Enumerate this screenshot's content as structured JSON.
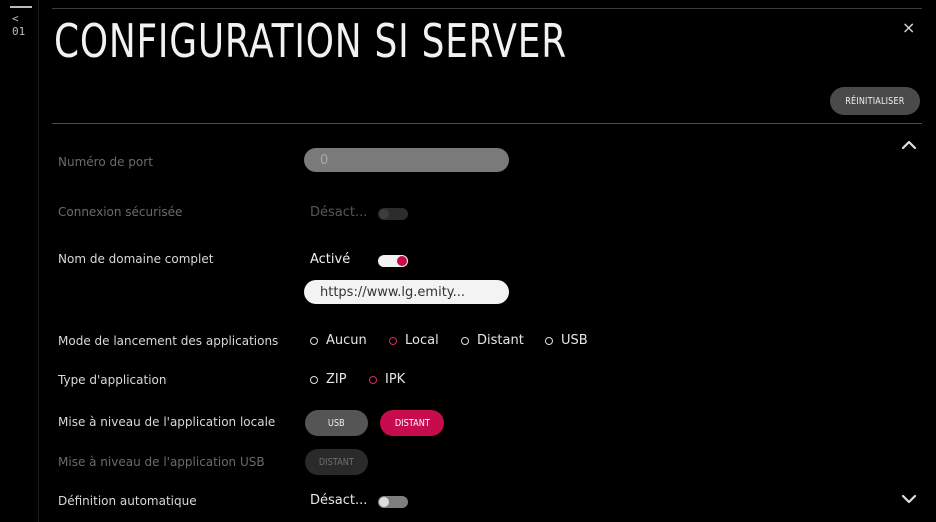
{
  "nav": {
    "back_label": "< 01"
  },
  "header": {
    "title": "CONFIGURATION SI SERVER",
    "reset_label": "RÉINITIALISER",
    "close_glyph": "×"
  },
  "settings": {
    "port": {
      "label": "Numéro de port",
      "value": "0"
    },
    "secure": {
      "label": "Connexion sécurisée",
      "value": "Désact..."
    },
    "fqdn": {
      "label": "Nom de domaine complet",
      "value": "Activé",
      "url": "https://www.lg.emity..."
    },
    "launch_mode": {
      "label": "Mode de lancement des applications",
      "options": [
        "Aucun",
        "Local",
        "Distant",
        "USB"
      ],
      "selected": "Local"
    },
    "app_type": {
      "label": "Type d'application",
      "options": [
        "ZIP",
        "IPK"
      ],
      "selected": "IPK"
    },
    "local_upgrade": {
      "label": "Mise à niveau de l'application locale",
      "usb": "USB",
      "distant": "DISTANT"
    },
    "usb_upgrade": {
      "label": "Mise à niveau de l'application USB",
      "distant": "DISTANT"
    },
    "auto_def": {
      "label": "Définition automatique",
      "value": "Désact..."
    }
  },
  "colors": {
    "background": "#000000",
    "accent": "#c70c4e",
    "text": "#e6e6e6",
    "disabled_text": "#6b6b6b"
  },
  "icons": {
    "close": "close-icon",
    "scroll_up": "chevron-up-icon",
    "scroll_down": "chevron-down-icon"
  }
}
